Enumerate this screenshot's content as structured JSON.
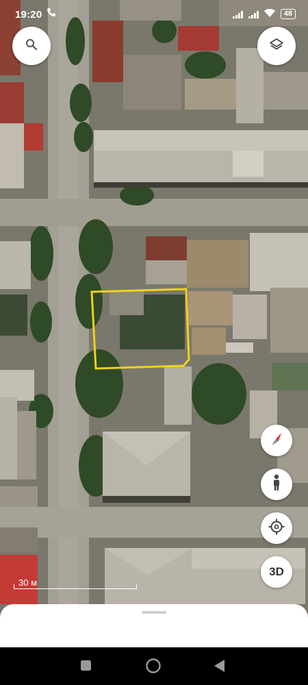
{
  "status_bar": {
    "time": "19:20",
    "battery": "48",
    "left_icons": [
      "phone-call-icon",
      "alarm-icon"
    ],
    "right_icons": [
      "signal-icon",
      "signal-icon",
      "wifi-icon",
      "battery-icon"
    ]
  },
  "map": {
    "view": "satellite",
    "highlight_outline_color": "#f2d21a",
    "scale_label": "30 м"
  },
  "controls": {
    "search": "search-icon",
    "layers": "layers-icon",
    "compass": "compass-icon",
    "street_view": "pegman-icon",
    "my_location": "my-location-icon",
    "three_d_label": "3D"
  },
  "nav_bar": {
    "buttons": [
      "recents-button",
      "home-button",
      "back-button"
    ]
  }
}
